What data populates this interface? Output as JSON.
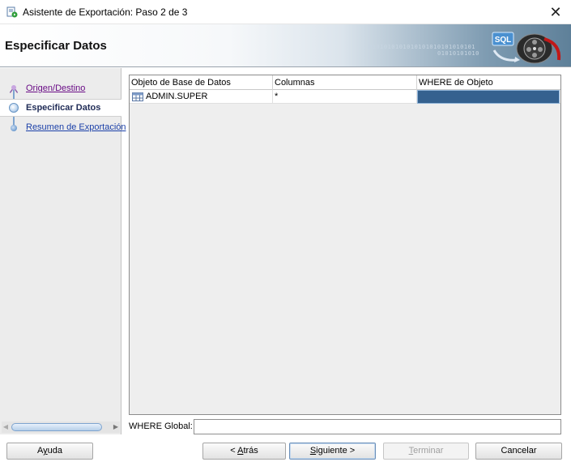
{
  "window": {
    "title": "Asistente de Exportación: Paso 2 de 3",
    "close_glyph": "✕"
  },
  "header": {
    "heading": "Especificar Datos",
    "binary_line1": "0101010101010101010101010101",
    "binary_line2": "01010101010",
    "logo_text": "SQL",
    "logo_icon": "sql-film-reel-icon"
  },
  "nav": {
    "items": [
      {
        "label": "Origen/Destino",
        "state": "visited"
      },
      {
        "label": "Especificar Datos",
        "state": "current"
      },
      {
        "label": "Resumen de Exportación",
        "state": "pending"
      }
    ]
  },
  "table": {
    "columns": [
      "Objeto de Base de Datos",
      "Columnas",
      "WHERE de Objeto"
    ],
    "rows": [
      {
        "object": "ADMIN.SUPER",
        "columns": "*",
        "where": ""
      }
    ],
    "row_icon": "table-icon"
  },
  "where_global": {
    "label": "WHERE Global:",
    "value": ""
  },
  "buttons": {
    "help_pre": "A",
    "help_mn": "y",
    "help_post": "uda",
    "back_pre": "< ",
    "back_mn": "A",
    "back_post": "trás",
    "next_pre": "",
    "next_mn": "S",
    "next_post": "iguiente >",
    "finish_pre": "",
    "finish_mn": "T",
    "finish_post": "erminar",
    "finish_enabled": false,
    "cancel": "Cancelar"
  },
  "colors": {
    "selected_cell": "#35618f",
    "nav_current": "#1f2b56",
    "link": "#1a3fa8",
    "visited_link": "#6a0d86"
  }
}
